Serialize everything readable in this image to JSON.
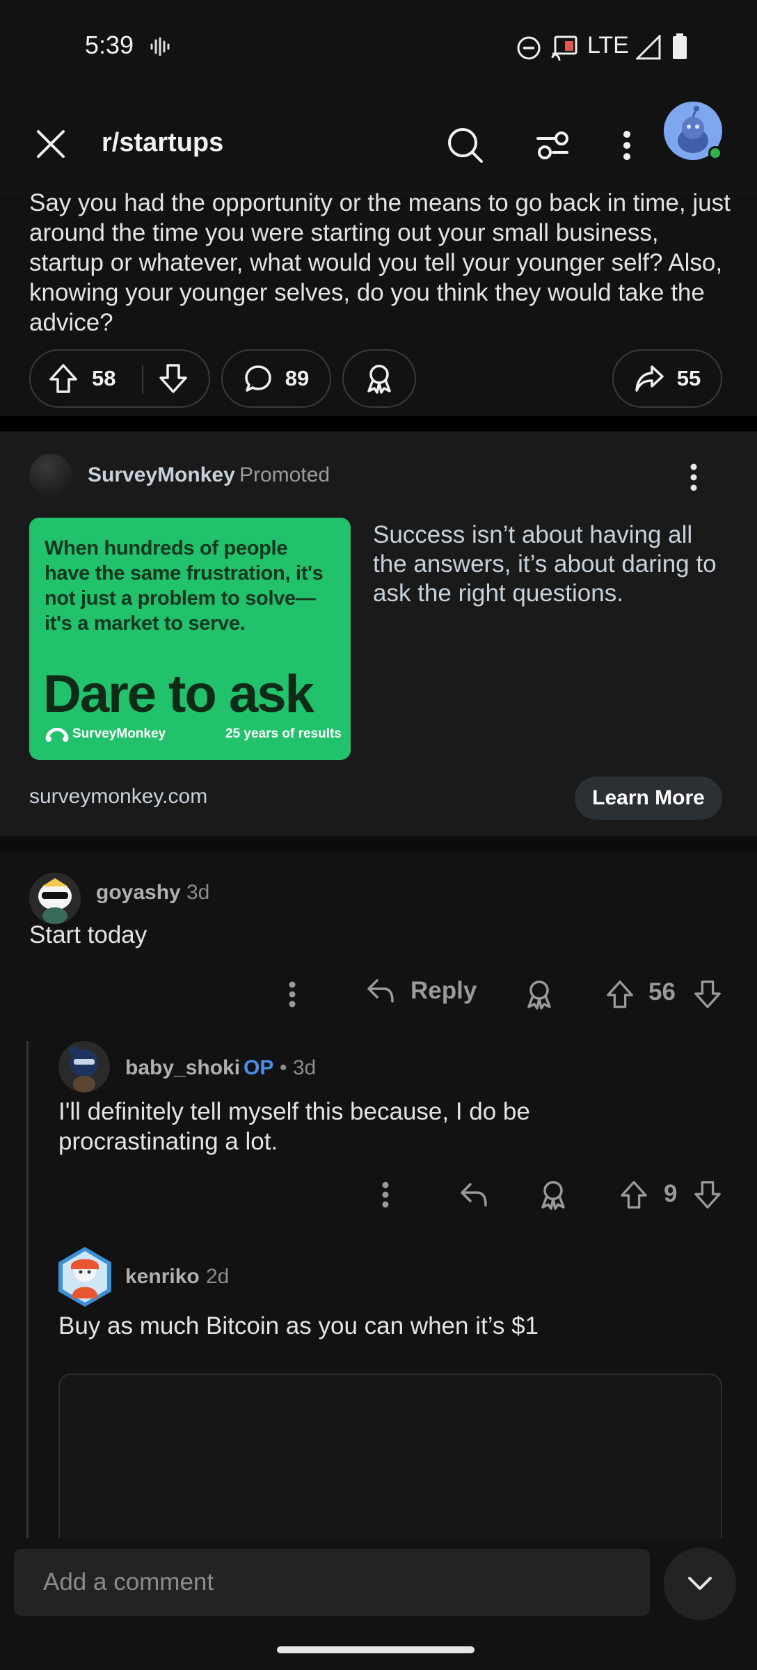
{
  "status_bar": {
    "time": "5:39",
    "network": "LTE",
    "icons": [
      "voicemail-icon",
      "dnd-icon",
      "cast-icon",
      "signal-icon",
      "battery-icon"
    ]
  },
  "header": {
    "subreddit": "r/startups",
    "icons": [
      "close-icon",
      "search-icon",
      "filter-icon",
      "more-vert-icon",
      "avatar"
    ]
  },
  "post": {
    "body": "Say you had the opportunity or the means to go back in time, just around the time you were starting out your small business, startup or whatever, what would you tell your younger self? Also, knowing your younger selves, do you think they would take the advice?",
    "upvotes": "58",
    "comments": "89",
    "shares": "55"
  },
  "ad": {
    "advertiser": "SurveyMonkey",
    "promoted_label": "Promoted",
    "image_text": "When hundreds of people have the same frustration, it's not just a problem to solve—it's a market to serve.",
    "image_headline": "Dare to ask",
    "image_brand": "SurveyMonkey",
    "image_tagline": "25 years of results",
    "description": "Success isn’t about having all the answers, it’s about daring to ask the right questions.",
    "domain": "surveymonkey.com",
    "cta": "Learn More",
    "image_color": "#22c16b"
  },
  "comments": [
    {
      "user": "goyashy",
      "age": "3d",
      "text": "Start today",
      "reply_label": "Reply",
      "score": "56"
    },
    {
      "user": "baby_shoki",
      "op_label": "OP",
      "age": "• 3d",
      "text": "I'll definitely tell myself this because, I do be procrastinating a lot.",
      "score": "9"
    },
    {
      "user": "kenriko",
      "age": "2d",
      "text": "Buy as much Bitcoin as you can when it’s $1"
    }
  ],
  "composer": {
    "placeholder": "Add a comment"
  },
  "colors": {
    "background": "#121212",
    "op": "#4d8fe6",
    "online": "#2fb34a"
  }
}
